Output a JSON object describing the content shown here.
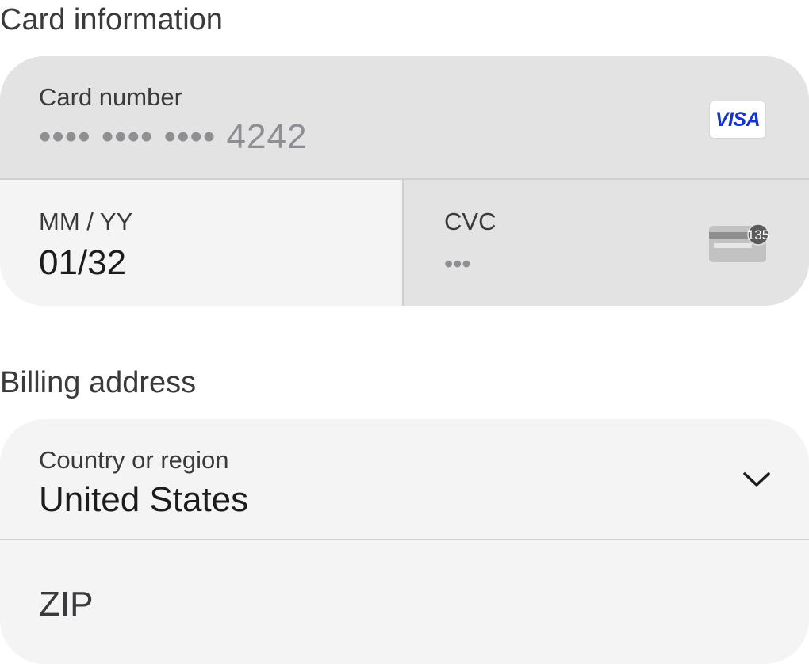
{
  "card_section": {
    "title": "Card information",
    "card_number": {
      "label": "Card number",
      "value": "•••• •••• •••• 4242",
      "brand": "VISA"
    },
    "expiry": {
      "label": "MM / YY",
      "value": "01/32"
    },
    "cvc": {
      "label": "CVC",
      "value": "•••",
      "hint_digits": "135"
    }
  },
  "billing_section": {
    "title": "Billing address",
    "country": {
      "label": "Country or region",
      "value": "United States"
    },
    "zip": {
      "placeholder": "ZIP"
    }
  },
  "icons": {
    "card_brand": "visa-logo",
    "cvc": "cvc-card-icon",
    "dropdown": "chevron-down-icon"
  },
  "colors": {
    "visa_blue": "#1434cb",
    "field_active_bg": "#f4f4f4",
    "field_inactive_bg": "#e3e3e3",
    "placeholder_text": "#8e8e93"
  }
}
